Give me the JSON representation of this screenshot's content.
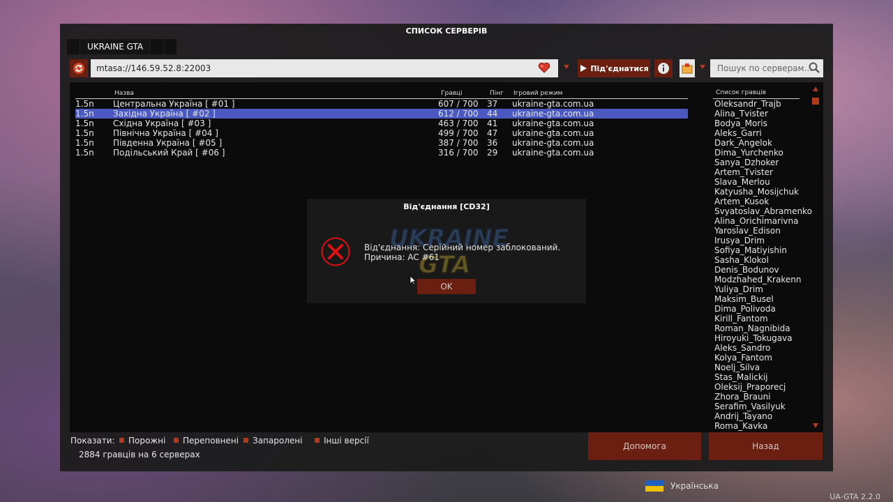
{
  "window": {
    "title": "СПИСОК СЕРВЕРІВ",
    "tab_label": "UKRAINE GTA"
  },
  "toolbar": {
    "address": "mtasa://146.59.52.8:22003",
    "connect_label": "Під'єднатися",
    "search_placeholder": "Пошук по серверам..."
  },
  "server_table": {
    "headers": {
      "name": "Назва",
      "players": "Гравці",
      "ping": "Пінг",
      "mode": "Ігровий режим"
    },
    "rows": [
      {
        "version": "1.5n",
        "name": "Центральна Україна [ #01 ]",
        "players": "607 / 700",
        "ping": "37",
        "mode": "ukraine-gta.com.ua",
        "selected": false
      },
      {
        "version": "1.5n",
        "name": "Західна Україна [ #02 ]",
        "players": "612 / 700",
        "ping": "44",
        "mode": "ukraine-gta.com.ua",
        "selected": true
      },
      {
        "version": "1.5n",
        "name": "Східна Україна [ #03 ]",
        "players": "463 / 700",
        "ping": "41",
        "mode": "ukraine-gta.com.ua",
        "selected": false
      },
      {
        "version": "1.5n",
        "name": "Північна Україна [ #04 ]",
        "players": "499 / 700",
        "ping": "47",
        "mode": "ukraine-gta.com.ua",
        "selected": false
      },
      {
        "version": "1.5n",
        "name": "Південна Україна [ #05 ]",
        "players": "387 / 700",
        "ping": "36",
        "mode": "ukraine-gta.com.ua",
        "selected": false
      },
      {
        "version": "1.5n",
        "name": "Подільський Край [ #06 ]",
        "players": "316 / 700",
        "ping": "29",
        "mode": "ukraine-gta.com.ua",
        "selected": false
      }
    ]
  },
  "players_panel": {
    "header": "Список гравців",
    "players": [
      "Oleksandr_Trajb",
      "Alina_Tvister",
      "Bodya_Moris",
      "Aleks_Garri",
      "Dark_Angelok",
      "Dima_Yurchenko",
      "Sanya_Dzhoker",
      "Artem_Tvister",
      "Slava_Merlou",
      "Katyusha_Mosijchuk",
      "Artem_Kusok",
      "Svyatoslav_Abramenko",
      "Alina_Orichimarivna",
      "Yaroslav_Edison",
      "Irusya_Drim",
      "Sofiya_Matiyishin",
      "Sasha_Klokol",
      "Denis_Bodunov",
      "Modzhahed_Krakenn",
      "Yuliya_Drim",
      "Maksim_Busel",
      "Dima_Polivoda",
      "Kirill_Fantom",
      "Roman_Nagnibida",
      "Hiroyuki_Tokugava",
      "Aleks_Sandro",
      "Kolya_Fantom",
      "Noelj_Silva",
      "Stas_Malickij",
      "Oleksij_Praporecj",
      "Zhora_Brauni",
      "Serafim_Vasilyuk",
      "Andrij_Tayano",
      "Roma_Kavka"
    ]
  },
  "filters": {
    "label": "Показати:",
    "items": [
      "Порожні",
      "Переповнені",
      "Запаролені",
      "Інші версії"
    ]
  },
  "status": "2884 гравців на 6 серверах",
  "buttons": {
    "help": "Допомога",
    "back": "Назад"
  },
  "dialog": {
    "title": "Від'єднання [CD32]",
    "message_line1": "Від'єднання: Серійний номер заблокований.",
    "message_line2": "Причина: AC #61",
    "ok": "OK"
  },
  "language": "Українська",
  "version": "UA-GTA 2.2.0",
  "colors": {
    "accent": "#6a1f10",
    "accent_bright": "#b03a1a",
    "selection": "#4a58c0",
    "error_red": "#e01010"
  },
  "icons": {
    "refresh": "refresh-icon",
    "favorite": "heart-icon",
    "info": "info-icon",
    "tools": "tools-icon",
    "search": "search-icon",
    "error": "error-x-icon"
  }
}
